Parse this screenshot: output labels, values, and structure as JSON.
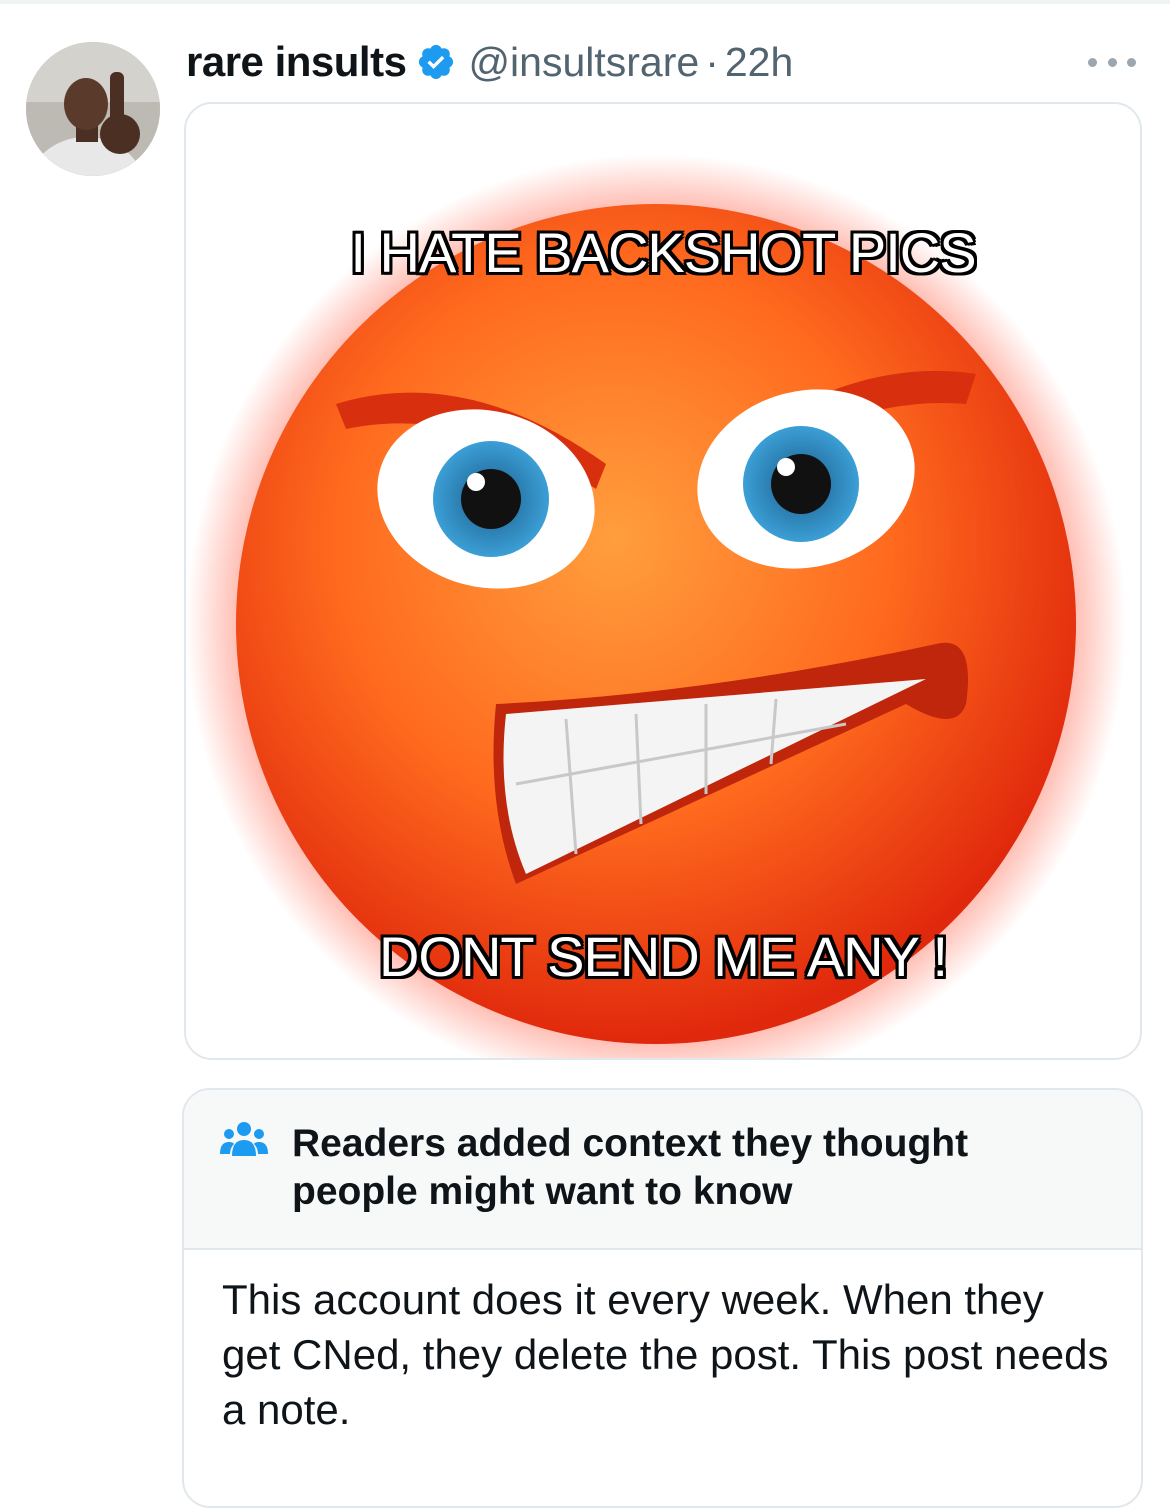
{
  "post": {
    "display_name": "rare insults",
    "verified_icon": "verified-badge-icon",
    "handle": "@insultsrare",
    "separator": "·",
    "time": "22h",
    "more_icon": "more-options-icon"
  },
  "media": {
    "top_text": "I HATE BACKSHOT PICS",
    "bottom_text": "DONT SEND ME ANY !"
  },
  "community_note": {
    "icon": "people-icon",
    "title": "Readers added context they thought people might want to know",
    "body": "This account does it every week. When they get CNed, they delete the post. This post needs a note."
  },
  "colors": {
    "accent": "#1d9bf0",
    "secondary_text": "#536471",
    "border": "#e1e8ed"
  }
}
